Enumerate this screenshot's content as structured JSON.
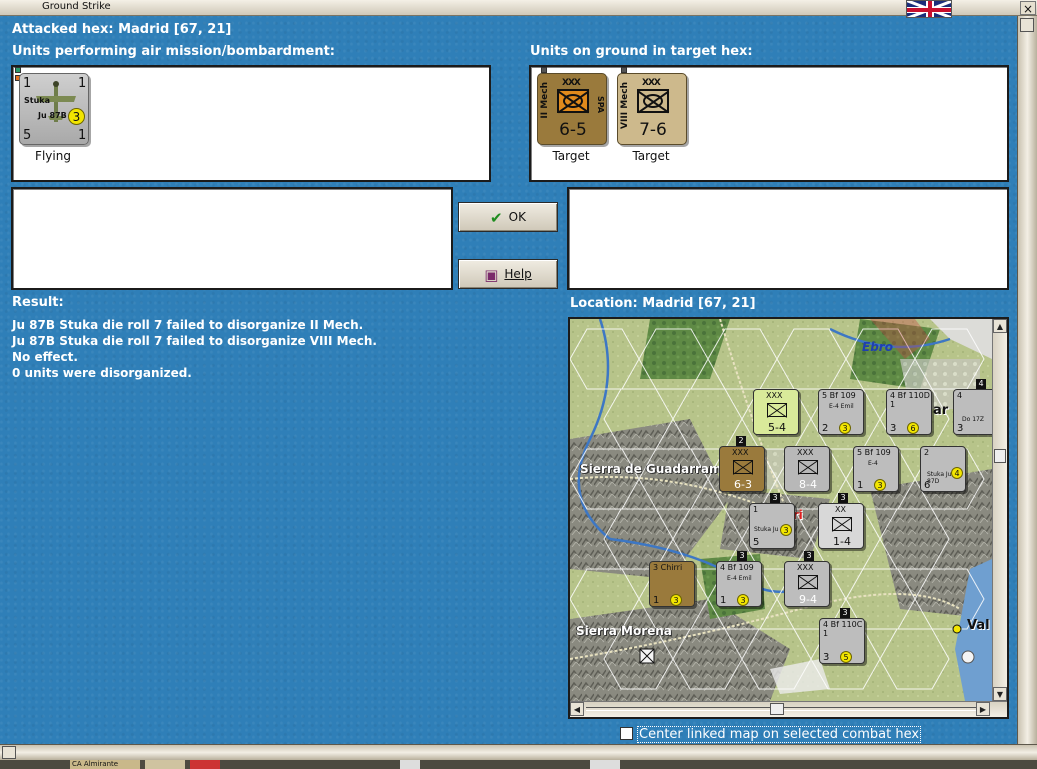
{
  "window": {
    "title": "Ground Strike",
    "close": "×"
  },
  "header": {
    "attacked_hex": "Attacked hex: Madrid  [67, 21]"
  },
  "air_units": {
    "label": "Units performing air mission/bombardment:",
    "items": [
      {
        "top_left": "1",
        "top_right": "1",
        "type": "Stuka",
        "model": "Ju 87B",
        "bottom_left": "5",
        "bottom_right": "1",
        "circle": "3",
        "status": "Flying"
      }
    ]
  },
  "ground_units": {
    "label": "Units on ground in target hex:",
    "items": [
      {
        "size": "XXX",
        "name": "II Mech",
        "nation": "SPA",
        "strength": "6-5",
        "status": "Target",
        "color": "#9a7a3c"
      },
      {
        "size": "XXX",
        "name": "VIII Mech",
        "nation": "",
        "strength": "7-6",
        "status": "Target",
        "color": "#cdb98c"
      }
    ]
  },
  "buttons": {
    "ok": "OK",
    "help": "Help"
  },
  "result": {
    "label": "Result:",
    "lines": [
      "Ju 87B Stuka die roll 7 failed to disorganize II Mech.",
      "Ju 87B Stuka die roll 7 failed to disorganize VIII Mech.",
      "No effect.",
      "0 units were disorganized."
    ]
  },
  "location": {
    "label": "Location:  Madrid  [67, 21]"
  },
  "map": {
    "labels": {
      "ebro": "Ebro",
      "guadarrama": "Sierra de Guadarram",
      "morena": "Sierra Morena",
      "madrid": "adri",
      "val": "Val",
      "zar": "ar"
    },
    "units": [
      {
        "id": "u1",
        "top": "XXX",
        "bottom": "5-4",
        "color": "#d9ea9a"
      },
      {
        "id": "u2",
        "top": "5 Bf 109",
        "sub": "E-4 Emil",
        "bottom": "2",
        "circle": "3",
        "color": "#bdbdbd"
      },
      {
        "id": "u3",
        "top": "4 Bf 110D 1",
        "bottom": "3",
        "circle": "6",
        "color": "#bdbdbd"
      },
      {
        "id": "u4",
        "top": "4",
        "sub": "Do 17Z",
        "bottom": "3",
        "color": "#bdbdbd"
      },
      {
        "id": "u5",
        "top": "XXX",
        "bottom": "6-3",
        "color": "#9a7a3c"
      },
      {
        "id": "u6",
        "top": "XXX",
        "bottom": "8-4",
        "color": "#b8b8b8"
      },
      {
        "id": "u7",
        "top": "5 Bf 109",
        "sub": "E-4",
        "bottom": "1",
        "circle": "3",
        "color": "#bdbdbd"
      },
      {
        "id": "u8",
        "top": "2",
        "sub": "Stuka Ju 87D",
        "bottom": "6",
        "circle": "4",
        "color": "#bdbdbd"
      },
      {
        "id": "u9",
        "top": "1",
        "sub": "Stuka Ju 87B",
        "bottom": "5",
        "circle": "3",
        "color": "#bdbdbd"
      },
      {
        "id": "u10",
        "top": "XX",
        "bottom": "1-4",
        "color": "#d8d8d8"
      },
      {
        "id": "u11",
        "top": "3 Chirri",
        "bottom": "1",
        "circle": "3",
        "color": "#9a7a3c"
      },
      {
        "id": "u12",
        "top": "4 Bf 109",
        "sub": "E-4 Emil",
        "bottom": "1",
        "circle": "3",
        "color": "#bdbdbd"
      },
      {
        "id": "u13",
        "top": "XXX",
        "bottom": "9-4",
        "color": "#bdbdbd"
      },
      {
        "id": "u14",
        "top": "4 Bf 110C 1",
        "bottom": "3",
        "circle": "5",
        "color": "#bdbdbd"
      }
    ]
  },
  "center_map": {
    "label": "Center linked map on selected combat hex"
  },
  "bottom_strip": {
    "item": "CA Almirante"
  }
}
